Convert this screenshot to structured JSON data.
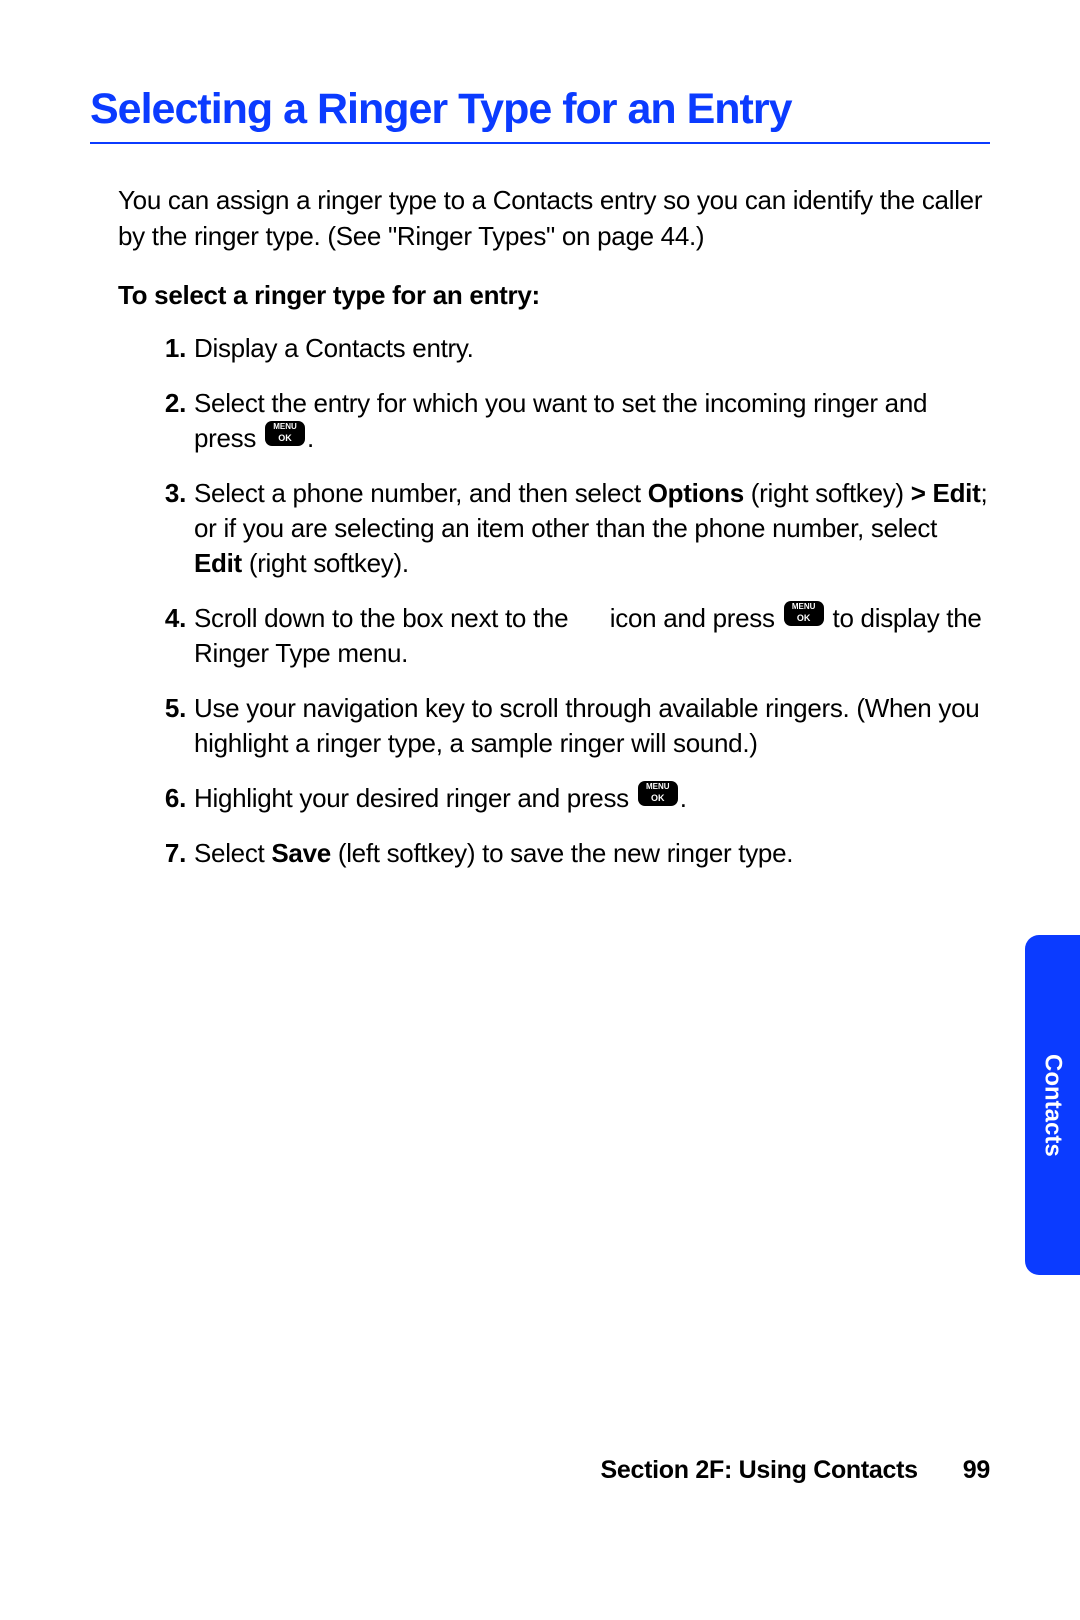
{
  "title": "Selecting a Ringer Type for an Entry",
  "intro": "You can assign a ringer type to a Contacts entry so you can identify the caller by the ringer type. (See \"Ringer Types\" on page 44.)",
  "subhead": "To select a ringer type for an entry:",
  "steps": {
    "s1": {
      "num": "1.",
      "text": "Display a Contacts entry."
    },
    "s2": {
      "num": "2.",
      "pre": "Select the entry for which you want to set the incoming ringer and press ",
      "post": "."
    },
    "s3": {
      "num": "3.",
      "pre": "Select a phone number, and then select ",
      "b1": "Options",
      "mid1": " (right softkey) ",
      "b2": "> Edit",
      "mid2": "; or if you are selecting an item other than the phone number, select ",
      "b3": "Edit",
      "post": " (right softkey)."
    },
    "s4": {
      "num": "4.",
      "pre": "Scroll down to the box next to the      icon and press ",
      "post": " to display the Ringer Type menu."
    },
    "s5": {
      "num": "5.",
      "text": "Use your navigation key to scroll through available ringers. (When you highlight a ringer type, a sample ringer will sound.)"
    },
    "s6": {
      "num": "6.",
      "pre": "Highlight your desired ringer and press ",
      "post": "."
    },
    "s7": {
      "num": "7.",
      "pre": "Select ",
      "b1": "Save",
      "post": " (left softkey) to save the new ringer type."
    }
  },
  "side_tab": "Contacts",
  "footer": {
    "section": "Section 2F: Using Contacts",
    "page": "99"
  }
}
